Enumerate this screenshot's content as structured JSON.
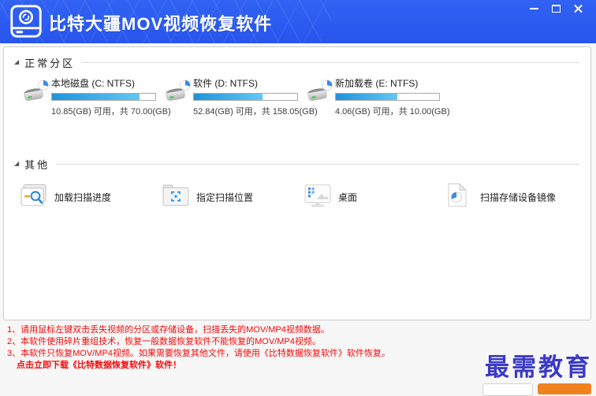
{
  "titlebar": {
    "title": "比特大疆MOV视频恢复软件"
  },
  "sections": {
    "partitions": {
      "marker": "◢",
      "title": "正常分区",
      "drives": [
        {
          "name": "本地磁盘 (C: NTFS)",
          "capacity": "10.85(GB) 可用，共 70.00(GB)",
          "used_percent": 84.5
        },
        {
          "name": "软件 (D: NTFS)",
          "capacity": "52.84(GB) 可用，共 158.05(GB)",
          "used_percent": 66.6
        },
        {
          "name": "新加载卷 (E: NTFS)",
          "capacity": "4.06(GB) 可用，共 10.00(GB)",
          "used_percent": 59.4
        }
      ]
    },
    "others": {
      "marker": "◢",
      "title": "其他",
      "items": [
        {
          "label": "加载扫描进度",
          "icon": "load-scan-progress-icon"
        },
        {
          "label": "指定扫描位置",
          "icon": "specify-scan-location-icon"
        },
        {
          "label": "桌面",
          "icon": "desktop-icon"
        },
        {
          "label": "扫描存储设备镜像",
          "icon": "scan-storage-image-icon"
        }
      ]
    }
  },
  "notices": {
    "lines": [
      "1、请用鼠标左键双击丢失视频的分区或存储设备，扫描丢失的MOV/MP4视频数据。",
      "2、本软件使用碎片重组技术，恢复一般数据恢复软件不能恢复的MOV/MP4视频。",
      "3、本软件只恢复MOV/MP4视频。如果需要恢复其他文件，请使用《比特数据恢复软件》软件恢复。"
    ],
    "download_link": "点击立即下载《比特数据恢复软件》软件！"
  },
  "watermark": {
    "text": "最需教育"
  },
  "colors": {
    "titlebar_blue": "#2b5af0",
    "bar_fill_start": "#1f93da",
    "bar_fill_end": "#63c7f3",
    "notice_red": "#f40b0b",
    "watermark_blue": "#3a3ac9",
    "cutoff_button_orange": "#f0821e"
  }
}
